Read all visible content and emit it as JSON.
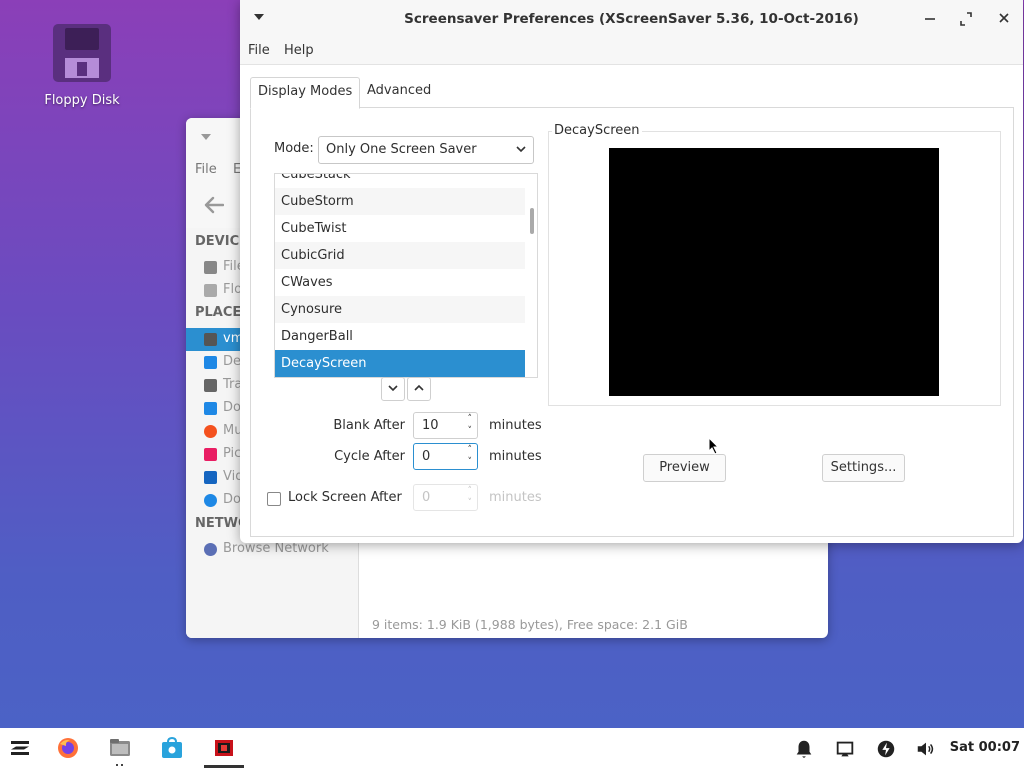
{
  "desktop": {
    "icons": [
      {
        "label": "Floppy Disk",
        "icon": "floppy-disk-icon"
      }
    ]
  },
  "file_manager": {
    "menu": [
      "File",
      "E"
    ],
    "sections": {
      "devices": "DEVICE",
      "places": "PLACE",
      "network": "NETWO"
    },
    "device_items": [
      "File",
      "Flo"
    ],
    "place_items": [
      {
        "label": "vm",
        "icon": "home-icon",
        "color": "#555555"
      },
      {
        "label": "De",
        "icon": "desktop-icon",
        "color": "#1e88e5"
      },
      {
        "label": "Tra",
        "icon": "trash-icon",
        "color": "#666666"
      },
      {
        "label": "Do",
        "icon": "documents-icon",
        "color": "#1e88e5"
      },
      {
        "label": "Mu",
        "icon": "music-icon",
        "color": "#f4511e"
      },
      {
        "label": "Pic",
        "icon": "pictures-icon",
        "color": "#e91e63"
      },
      {
        "label": "Vid",
        "icon": "videos-icon",
        "color": "#1565c0"
      },
      {
        "label": "Do",
        "icon": "downloads-icon",
        "color": "#1e88e5"
      }
    ],
    "network_items": [
      "Browse Network"
    ],
    "status": "9 items: 1.9 KiB (1,988 bytes), Free space: 2.1 GiB"
  },
  "window": {
    "title": "Screensaver Preferences  (XScreenSaver 5.36, 10-Oct-2016)",
    "menu": [
      "File",
      "Help"
    ],
    "tabs": [
      "Display Modes",
      "Advanced"
    ],
    "mode_label": "Mode:",
    "mode_value": "Only One Screen Saver",
    "list": [
      "CubeStack",
      "CubeStorm",
      "CubeTwist",
      "CubicGrid",
      "CWaves",
      "Cynosure",
      "DangerBall",
      "DecayScreen"
    ],
    "selected": "DecayScreen",
    "preview_label": "DecayScreen",
    "blank_after": {
      "label": "Blank After",
      "value": "10",
      "unit": "minutes"
    },
    "cycle_after": {
      "label": "Cycle After",
      "value": "0",
      "unit": "minutes"
    },
    "lock_after": {
      "label": "Lock Screen After",
      "value": "0",
      "unit": "minutes",
      "checked": false
    },
    "preview_button": "Preview",
    "settings_button": "Settings..."
  },
  "taskbar": {
    "clock": "Sat 00:07",
    "apps": [
      "zorin-menu-icon",
      "firefox-icon",
      "files-icon",
      "software-store-icon",
      "xscreensaver-icon"
    ],
    "tray": [
      "bell-icon",
      "display-icon",
      "power-icon",
      "volume-icon"
    ]
  },
  "colors": {
    "accent": "#2b8fd0",
    "preview": "#000000"
  }
}
